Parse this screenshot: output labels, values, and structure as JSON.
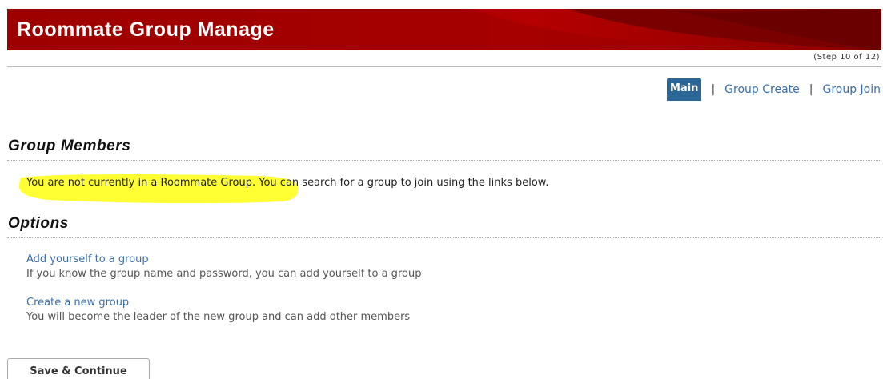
{
  "header": {
    "title": "Roommate Group Manage",
    "step": "(Step 10 of 12)",
    "colors": {
      "banner_dark": "#7d0000",
      "banner_light": "#b30000"
    }
  },
  "nav": {
    "main_label": "Main",
    "separator": "|",
    "group_create_label": "Group Create",
    "group_join_label": "Group Join",
    "active_color": "#2a6796",
    "link_color": "#3b6ea8"
  },
  "group_members": {
    "heading": "Group Members",
    "message_highlighted": "You are not currently in a Roommate Group",
    "message_rest": ". You can search for a group to join using the links below.",
    "highlight_color": "#ffff33"
  },
  "options": {
    "heading": "Options",
    "items": [
      {
        "link": "Add yourself to a group",
        "description": "If you know the group name and password, you can add yourself to a group"
      },
      {
        "link": "Create a new group",
        "description": "You will become the leader of the new group and can add other members"
      }
    ]
  },
  "footer": {
    "save_label": "Save & Continue"
  }
}
